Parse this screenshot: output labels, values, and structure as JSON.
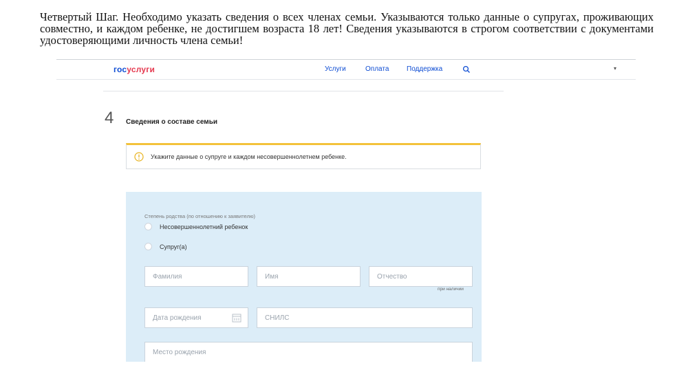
{
  "instruction": "Четвертый Шаг. Необходимо указать сведения о всех членах семьи. Указываются только данные о супругах, проживающих совместно, и каждом ребенке, не достигшем возраста 18 лет! Сведения указываются в строгом соответствии с документами удостоверяющими личность члена семьи!",
  "header": {
    "logo_part1": "гос",
    "logo_part2": "услуги",
    "nav": [
      "Услуги",
      "Оплата",
      "Поддержка"
    ],
    "search_icon": "search-icon",
    "user_menu": "▾"
  },
  "step": {
    "number": "4",
    "title": "Сведения о составе семьи"
  },
  "notice": {
    "icon": "warning-icon",
    "text": "Укажите данные о супруге и каждом несовершеннолетнем ребенке."
  },
  "form": {
    "relation_label": "Степень родства (по отношению к заявителю)",
    "options": [
      "Несовершеннолетний ребенок",
      "Супруг(а)"
    ],
    "fields": {
      "last_name": "Фамилия",
      "first_name": "Имя",
      "middle_name": "Отчество",
      "middle_name_hint": "при наличии",
      "birth_date": "Дата рождения",
      "snils": "СНИЛС",
      "birth_place": "Место рождения"
    },
    "calendar_icon": "calendar-icon"
  },
  "colors": {
    "brand_blue": "#0d4cd3",
    "brand_red": "#e5394f",
    "notice_accent": "#f3c23a",
    "form_background": "#dcedf8"
  }
}
